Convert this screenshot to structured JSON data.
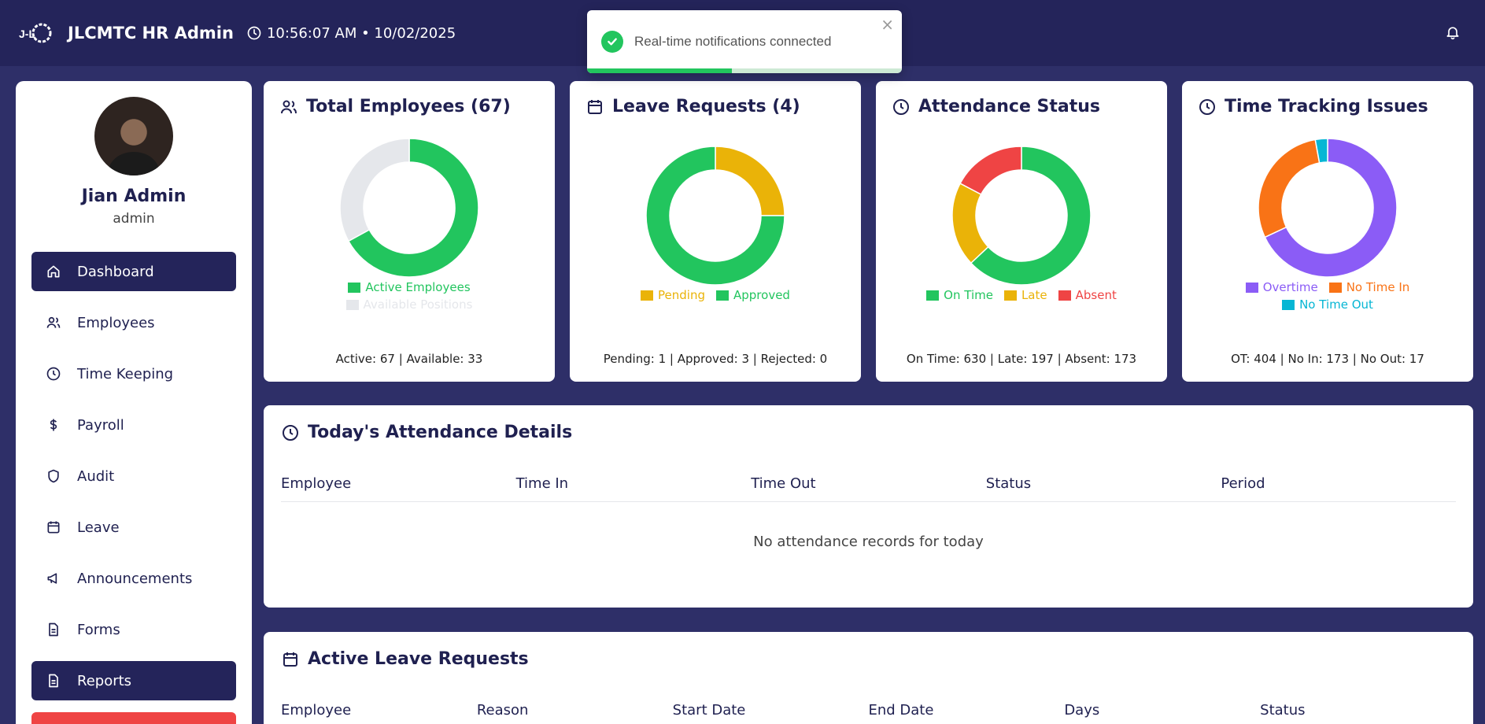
{
  "header": {
    "title": "JLCMTC HR Admin",
    "datetime": "10:56:07 AM • 10/02/2025"
  },
  "toast": {
    "message": "Real-time notifications connected",
    "progress": 0.46
  },
  "user": {
    "name": "Jian Admin",
    "role": "admin"
  },
  "sidebar": {
    "items": [
      {
        "label": "Dashboard",
        "icon": "home-icon",
        "active": true
      },
      {
        "label": "Employees",
        "icon": "users-icon",
        "active": false
      },
      {
        "label": "Time Keeping",
        "icon": "clock-icon",
        "active": false
      },
      {
        "label": "Payroll",
        "icon": "dollar-icon",
        "active": false
      },
      {
        "label": "Audit",
        "icon": "shield-icon",
        "active": false
      },
      {
        "label": "Leave",
        "icon": "calendar-icon",
        "active": false
      },
      {
        "label": "Announcements",
        "icon": "megaphone-icon",
        "active": false
      },
      {
        "label": "Forms",
        "icon": "file-icon",
        "active": false
      },
      {
        "label": "Reports",
        "icon": "file-icon",
        "active": true
      }
    ]
  },
  "cards": {
    "employees": {
      "title": "Total Employees (67)",
      "summary": "Active: 67 | Available: 33"
    },
    "leave": {
      "title": "Leave Requests (4)",
      "summary": "Pending: 1 | Approved: 3 | Rejected: 0"
    },
    "attendance": {
      "title": "Attendance Status",
      "summary": "On Time: 630 | Late: 197 | Absent: 173"
    },
    "tracking": {
      "title": "Time Tracking Issues",
      "summary": "OT: 404 | No In: 173 | No Out: 17"
    }
  },
  "attendance_details": {
    "title": "Today's Attendance Details",
    "columns": [
      "Employee",
      "Time In",
      "Time Out",
      "Status",
      "Period"
    ],
    "empty_message": "No attendance records for today"
  },
  "leave_requests": {
    "title": "Active Leave Requests",
    "columns": [
      "Employee",
      "Reason",
      "Start Date",
      "End Date",
      "Days",
      "Status"
    ]
  },
  "chart_data": [
    {
      "type": "pie",
      "categories": [
        "Active Employees",
        "Available Positions"
      ],
      "values": [
        67,
        33
      ],
      "colors": [
        "#22c55e",
        "#e5e7eb"
      ]
    },
    {
      "type": "pie",
      "categories": [
        "Pending",
        "Approved"
      ],
      "values": [
        1,
        3
      ],
      "colors": [
        "#eab308",
        "#22c55e"
      ]
    },
    {
      "type": "pie",
      "categories": [
        "On Time",
        "Late",
        "Absent"
      ],
      "values": [
        630,
        197,
        173
      ],
      "colors": [
        "#22c55e",
        "#eab308",
        "#ef4444"
      ]
    },
    {
      "type": "pie",
      "categories": [
        "Overtime",
        "No Time In",
        "No Time Out"
      ],
      "values": [
        404,
        173,
        17
      ],
      "colors": [
        "#8b5cf6",
        "#f97316",
        "#06b6d4"
      ]
    }
  ]
}
